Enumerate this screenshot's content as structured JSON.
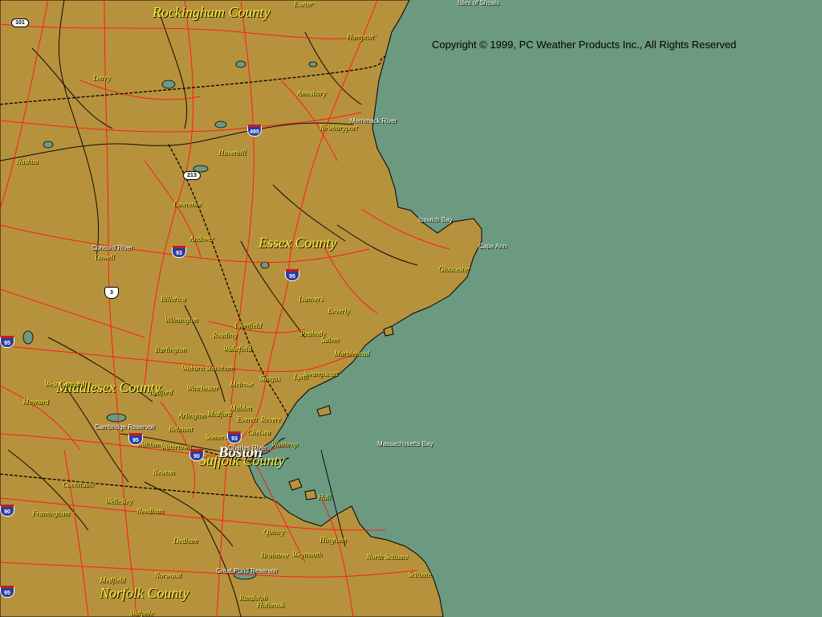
{
  "copyright": "Copyright © 1999, PC Weather Products Inc., All Rights Reserved",
  "colors": {
    "land": "#b7923c",
    "water": "#6b9a80",
    "roads": "#ff1a1a",
    "rivers": "#0a0a0a",
    "label": "#f5ef3a"
  },
  "counties": [
    {
      "name": "Rockingham County"
    },
    {
      "name": "Essex County"
    },
    {
      "name": "Middlesex County"
    },
    {
      "name": "Suffolk County"
    },
    {
      "name": "Norfolk County"
    }
  ],
  "major_city": "Boston",
  "towns": [
    "Exeter",
    "Hampton",
    "Derry",
    "Amesbury",
    "Newburyport",
    "Haverhill",
    "Nashua",
    "Lawrence",
    "Andover",
    "Lowell",
    "Danvers",
    "Beverly",
    "Gloucester",
    "Wilmington",
    "Lynnfield",
    "Peabody",
    "Salem",
    "Reading",
    "Wakefield",
    "Burlington",
    "Marblehead",
    "Woburn",
    "Stoneham",
    "Saugus",
    "Lynn",
    "Swampscott",
    "Winchester",
    "Melrose",
    "West Concord",
    "Bedford",
    "Maynard",
    "Arlington",
    "Medford",
    "Malden",
    "Everett",
    "Revere",
    "Chelsea",
    "Belmont",
    "Winthrop",
    "Somerville",
    "Waltham",
    "Watertown",
    "Newton",
    "Cochituate",
    "Wellesley",
    "Framingham",
    "Needham",
    "Hull",
    "Quincy",
    "Hingham",
    "Dedham",
    "Braintree",
    "Weymouth",
    "North Scituate",
    "Scituate",
    "Medfield",
    "Norwood",
    "Randolph",
    "Holbrook",
    "Walpole",
    "Billerica"
  ],
  "water_features": [
    "Isles of Shoals",
    "Merrimack River",
    "Ipswich Bay",
    "Cape Ann",
    "Concord River",
    "Cambridge Reservoir",
    "Charles River",
    "Massachusetts Bay",
    "Great Pond Reservoir"
  ],
  "highways": [
    {
      "type": "interstate",
      "number": "495"
    },
    {
      "type": "interstate",
      "number": "93"
    },
    {
      "type": "interstate",
      "number": "95"
    },
    {
      "type": "interstate",
      "number": "90"
    },
    {
      "type": "us",
      "number": "3"
    },
    {
      "type": "state",
      "number": "213"
    },
    {
      "type": "state",
      "number": "101"
    }
  ]
}
